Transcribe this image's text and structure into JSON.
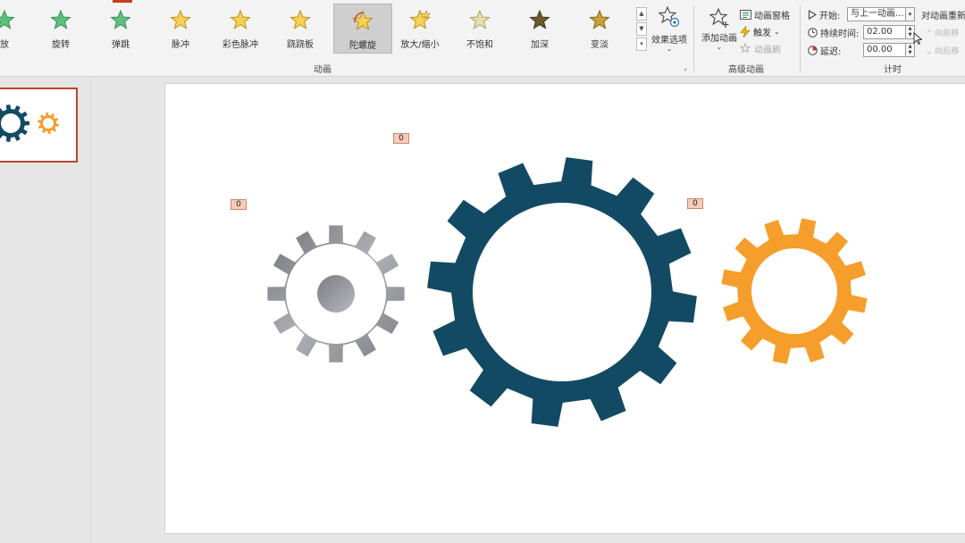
{
  "ribbon": {
    "effects": [
      {
        "label": "放",
        "icon": "star-green-icon"
      },
      {
        "label": "旋转",
        "icon": "star-spin-icon"
      },
      {
        "label": "弹跳",
        "icon": "star-bounce-icon"
      },
      {
        "label": "脉冲",
        "icon": "star-pulse-icon"
      },
      {
        "label": "彩色脉冲",
        "icon": "star-color-pulse-icon"
      },
      {
        "label": "跷跷板",
        "icon": "star-teeter-icon"
      },
      {
        "label": "陀螺旋",
        "icon": "star-spin-gold-icon"
      },
      {
        "label": "放大/缩小",
        "icon": "star-grow-shrink-icon"
      },
      {
        "label": "不饱和",
        "icon": "star-desaturate-icon"
      },
      {
        "label": "加深",
        "icon": "star-darken-icon"
      },
      {
        "label": "变淡",
        "icon": "star-lighten-icon"
      }
    ],
    "selected_effect": "陀螺旋",
    "effect_options_label": "效果选项",
    "animation_group_label": "动画",
    "add_animation_label": "添加动画",
    "animation_pane_label": "动画窗格",
    "trigger_label": "触发",
    "animation_painter_label": "动画刷",
    "advanced_group_label": "高级动画",
    "start_label": "开始:",
    "start_value": "与上一动画...",
    "duration_label": "持续时间:",
    "duration_value": "02.00",
    "delay_label": "延迟:",
    "delay_value": "00.00",
    "timing_group_label": "计时",
    "reorder_title": "对动画重新",
    "move_earlier_label": "向前移",
    "move_later_label": "向后移"
  },
  "slide": {
    "tags": [
      "0",
      "0",
      "0"
    ]
  },
  "colors": {
    "navy": "#134a63",
    "orange": "#f59e2b",
    "gray": "#8a8b90",
    "selection": "#b7472a"
  }
}
